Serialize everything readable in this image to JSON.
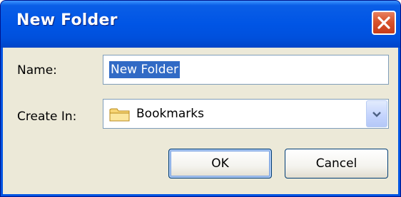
{
  "dialog": {
    "title": "New Folder",
    "close_icon": "close-icon"
  },
  "form": {
    "name_label": "Name:",
    "name_value": "New Folder",
    "create_in_label": "Create In:",
    "create_in_value": "Bookmarks",
    "create_in_icon": "folder-icon",
    "dropdown_icon": "chevron-down-icon"
  },
  "buttons": {
    "ok_label": "OK",
    "cancel_label": "Cancel"
  },
  "colors": {
    "titlebar": "#0055e5",
    "selection": "#316ac5",
    "client_bg": "#ece9d8",
    "close_button": "#d8532c"
  }
}
